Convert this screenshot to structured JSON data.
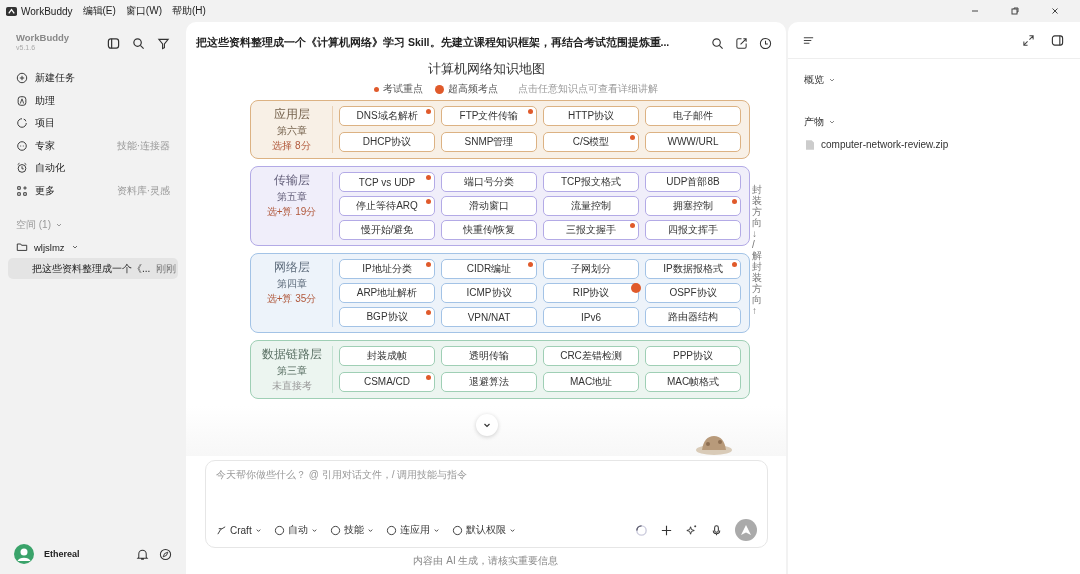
{
  "menu_bar": {
    "app": "WorkBuddy",
    "menus": [
      "编辑(E)",
      "窗口(W)",
      "帮助(H)"
    ]
  },
  "sidebar": {
    "app_name": "WorkBuddy",
    "version": "v5.1.6",
    "nav": [
      {
        "label": "新建任务"
      },
      {
        "label": "助理"
      },
      {
        "label": "项目"
      },
      {
        "label": "专家",
        "hint": "技能·连接器"
      },
      {
        "label": "自动化"
      },
      {
        "label": "更多",
        "hint": "资料库·灵感"
      }
    ],
    "space": {
      "label": "空间 (1)",
      "folder": "wljslmz",
      "tasks": [
        {
          "title": "把这些资料整理成一个《...",
          "time": "刚刚",
          "selected": true
        }
      ]
    },
    "user": {
      "name": "Ethereal"
    }
  },
  "chat": {
    "title": "把这些资料整理成一个《计算机网络》学习 Skill。先建立课程知识框架，再结合考试范围提炼重...",
    "map": {
      "title": "计算机网络知识地图",
      "legend": [
        {
          "label": "考试重点",
          "kind": "key"
        },
        {
          "label": "超高频考点",
          "kind": "hot"
        }
      ],
      "legend_hint": "点击任意知识点可查看详细讲解",
      "side_note": "封装方向 ↓ / 解封装方向 ↑",
      "layers": [
        {
          "name": "应用层",
          "chapter": "第六章",
          "score": "选择 8分",
          "examined": true,
          "color": "#dcb283",
          "items": [
            {
              "label": "DNS域名解析",
              "key": true,
              "hot": false
            },
            {
              "label": "FTP文件传输",
              "key": true,
              "hot": false
            },
            {
              "label": "HTTP协议",
              "key": false,
              "hot": false
            },
            {
              "label": "电子邮件",
              "key": false,
              "hot": false
            },
            {
              "label": "DHCP协议",
              "key": false,
              "hot": false
            },
            {
              "label": "SNMP管理",
              "key": false,
              "hot": false
            },
            {
              "label": "C/S模型",
              "key": true,
              "hot": false
            },
            {
              "label": "WWW/URL",
              "key": false,
              "hot": false
            }
          ]
        },
        {
          "name": "传输层",
          "chapter": "第五章",
          "score": "选+算 19分",
          "examined": true,
          "color": "#b3aae6",
          "items": [
            {
              "label": "TCP vs UDP",
              "key": true,
              "hot": false
            },
            {
              "label": "端口号分类",
              "key": false,
              "hot": false
            },
            {
              "label": "TCP报文格式",
              "key": false,
              "hot": false
            },
            {
              "label": "UDP首部8B",
              "key": false,
              "hot": false
            },
            {
              "label": "停止等待ARQ",
              "key": true,
              "hot": false
            },
            {
              "label": "滑动窗口",
              "key": false,
              "hot": false
            },
            {
              "label": "流量控制",
              "key": false,
              "hot": false
            },
            {
              "label": "拥塞控制",
              "key": true,
              "hot": false
            },
            {
              "label": "慢开始/避免",
              "key": false,
              "hot": false
            },
            {
              "label": "快重传/恢复",
              "key": false,
              "hot": false
            },
            {
              "label": "三报文握手",
              "key": true,
              "hot": false
            },
            {
              "label": "四报文挥手",
              "key": false,
              "hot": false
            }
          ]
        },
        {
          "name": "网络层",
          "chapter": "第四章",
          "score": "选+算 35分",
          "examined": true,
          "color": "#a3c3e6",
          "items": [
            {
              "label": "IP地址分类",
              "key": true,
              "hot": false
            },
            {
              "label": "CIDR编址",
              "key": true,
              "hot": false
            },
            {
              "label": "子网划分",
              "key": false,
              "hot": false
            },
            {
              "label": "IP数据报格式",
              "key": true,
              "hot": false
            },
            {
              "label": "ARP地址解析",
              "key": false,
              "hot": false
            },
            {
              "label": "ICMP协议",
              "key": false,
              "hot": false
            },
            {
              "label": "RIP协议",
              "key": false,
              "hot": true
            },
            {
              "label": "OSPF协议",
              "key": false,
              "hot": false
            },
            {
              "label": "BGP协议",
              "key": true,
              "hot": false
            },
            {
              "label": "VPN/NAT",
              "key": false,
              "hot": false
            },
            {
              "label": "IPv6",
              "key": false,
              "hot": false
            },
            {
              "label": "路由器结构",
              "key": false,
              "hot": false
            }
          ]
        },
        {
          "name": "数据链路层",
          "chapter": "第三章",
          "score": "未直接考",
          "examined": false,
          "color": "#9fcfb5",
          "items": [
            {
              "label": "封装成帧",
              "key": false,
              "hot": false
            },
            {
              "label": "透明传输",
              "key": false,
              "hot": false
            },
            {
              "label": "CRC差错检测",
              "key": false,
              "hot": false
            },
            {
              "label": "PPP协议",
              "key": false,
              "hot": false
            },
            {
              "label": "CSMA/CD",
              "key": true,
              "hot": false
            },
            {
              "label": "退避算法",
              "key": false,
              "hot": false
            },
            {
              "label": "MAC地址",
              "key": false,
              "hot": false
            },
            {
              "label": "MAC帧格式",
              "key": false,
              "hot": false
            }
          ]
        }
      ]
    },
    "composer": {
      "placeholder": "今天帮你做些什么？ @ 引用对话文件，/ 调用技能与指令",
      "tools": [
        "Craft",
        "自动",
        "技能",
        "连应用",
        "默认权限"
      ]
    },
    "footer": "内容由 AI 生成，请核实重要信息"
  },
  "panel": {
    "sections": [
      "概览",
      "产物"
    ],
    "files": [
      "computer-network-review.zip"
    ]
  }
}
